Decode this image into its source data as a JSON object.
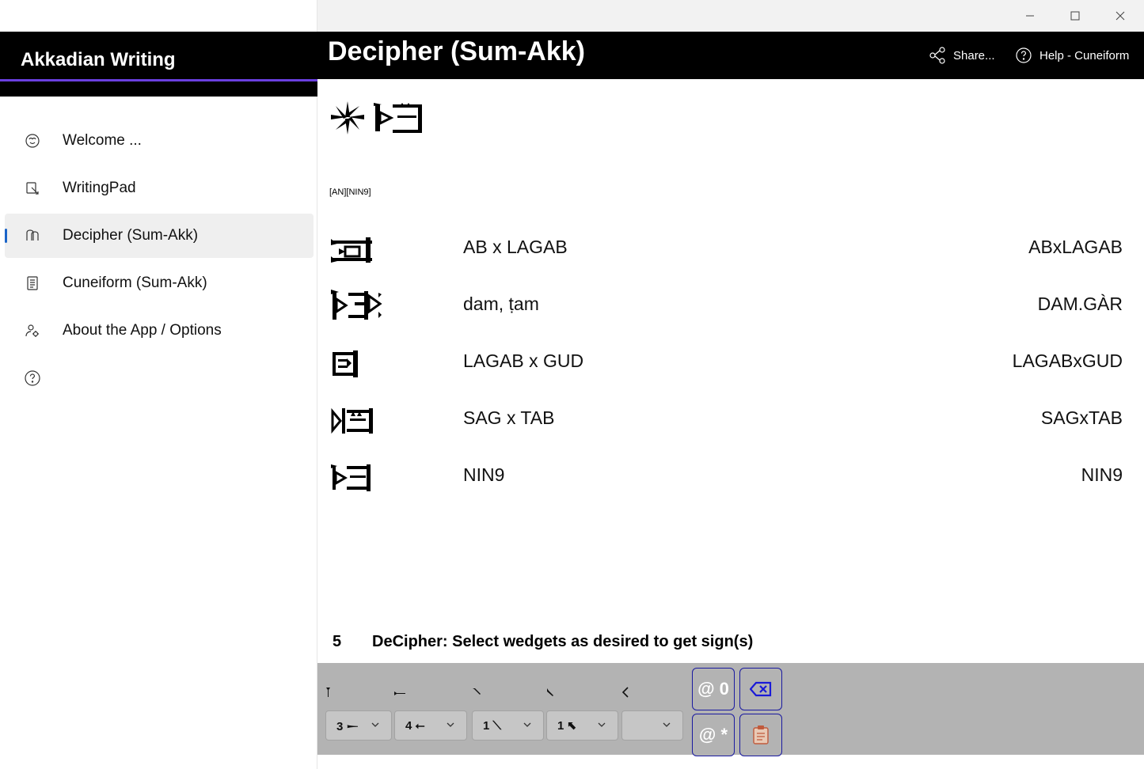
{
  "sidebar": {
    "app_title": "Akkadian Writing",
    "items": [
      {
        "label": "Welcome ...",
        "icon": "brain-icon"
      },
      {
        "label": "WritingPad",
        "icon": "pad-icon"
      },
      {
        "label": "Decipher (Sum-Akk)",
        "icon": "decipher-icon"
      },
      {
        "label": "Cuneiform (Sum-Akk)",
        "icon": "list-icon"
      },
      {
        "label": "About the App / Options",
        "icon": "person-gear-icon"
      },
      {
        "label": "",
        "icon": "help-circle-icon"
      }
    ],
    "selected_index": 2
  },
  "header": {
    "title": "Decipher (Sum-Akk)",
    "share_label": "Share...",
    "help_label": "Help - Cuneiform"
  },
  "input": {
    "transliteration": "[AN][NIN9]"
  },
  "signs": [
    {
      "name": "AB x LAGAB",
      "code": "ABxLAGAB"
    },
    {
      "name": "dam, ṭam",
      "code": "DAM.GÀR"
    },
    {
      "name": "LAGAB x GUD",
      "code": "LAGABxGUD"
    },
    {
      "name": "SAG x TAB",
      "code": "SAGxTAB"
    },
    {
      "name": "NIN9",
      "code": "NIN9"
    }
  ],
  "status": {
    "count": "5",
    "message": "DeCipher: Select wedgets as desired to get sign(s)"
  },
  "keypad": {
    "combos": [
      "3 𒀸",
      "4 ⭠",
      "1 ⟍",
      "1 ⬉",
      ""
    ],
    "buttons": {
      "at_zero": "@ 0",
      "at_star": "@ *"
    }
  },
  "colors": {
    "accent": "#6a3fe0",
    "selection_bar": "#1a64c8",
    "keypad_bg": "#b3b3b3",
    "button_border": "#1a1aa0"
  }
}
